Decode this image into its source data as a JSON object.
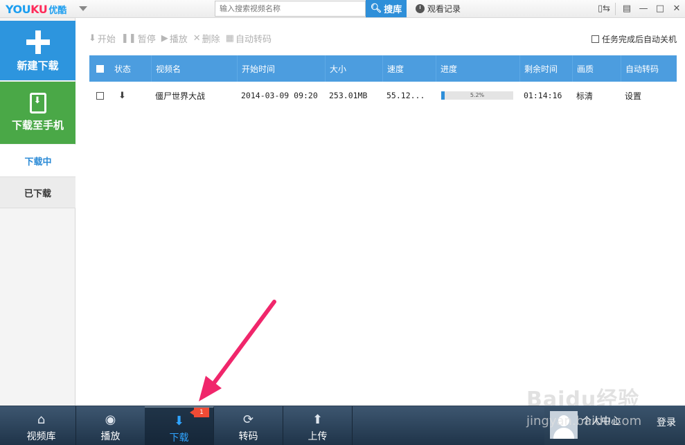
{
  "logo": {
    "en_prefix": "YOU",
    "en_suffix": "KU",
    "cn": "优酷"
  },
  "search": {
    "placeholder": "输入搜索视频名称",
    "button_label": "搜库"
  },
  "history_label": "观看记录",
  "sidebar": {
    "new_download": "新建下载",
    "download_to_phone": "下载至手机",
    "tab_downloading": "下载中",
    "tab_downloaded": "已下载"
  },
  "toolbar": {
    "start": "开始",
    "pause": "暂停",
    "play": "播放",
    "delete": "删除",
    "auto_convert": "自动转码",
    "auto_shutdown": "任务完成后自动关机"
  },
  "table": {
    "headers": [
      "状态",
      "视频名",
      "开始时间",
      "大小",
      "速度",
      "进度",
      "剩余时间",
      "画质",
      "自动转码"
    ],
    "rows": [
      {
        "name": "僵尸世界大战",
        "start_time": "2014-03-09 09:20",
        "size": "253.01MB",
        "speed": "55.12...",
        "progress_text": "5.2%",
        "progress": 0.052,
        "remaining": "01:14:16",
        "quality": "标清",
        "auto_convert": "设置"
      }
    ]
  },
  "bottom_nav": {
    "library": "视频库",
    "play": "播放",
    "download": "下载",
    "convert": "转码",
    "upload": "上传",
    "download_badge": "1"
  },
  "user": {
    "center": "个人中心",
    "login": "登录"
  },
  "watermark": {
    "brand": "Baidu经验",
    "url": "jingyan.baidu.com"
  },
  "colors": {
    "accent_blue": "#2d95de",
    "phone_green": "#4aa847",
    "arrow": "#f0266b",
    "nav_bg": "#2c4359"
  }
}
